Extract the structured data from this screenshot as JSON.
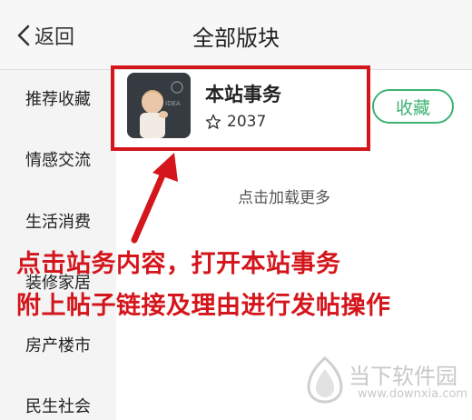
{
  "header": {
    "back_label": "返回",
    "title": "全部版块"
  },
  "sidebar": {
    "items": [
      {
        "label": "推荐收藏"
      },
      {
        "label": "情感交流"
      },
      {
        "label": "生活消费"
      },
      {
        "label": "装修家居"
      },
      {
        "label": "房产楼市"
      },
      {
        "label": "民生社会"
      }
    ]
  },
  "board": {
    "name": "本站事务",
    "star_count": "2037",
    "favorite_label": "收藏"
  },
  "list": {
    "load_more_label": "点击加载更多"
  },
  "annotation": {
    "line1": "点击站务内容，打开本站事务",
    "line2": "附上帖子链接及理由进行发帖操作",
    "color": "#d4161c"
  },
  "watermark": {
    "name": "当下软件园",
    "url": "www.downxia.com"
  },
  "colors": {
    "accent_green": "#3cb371",
    "annotation_red": "#d4161c"
  },
  "icons": {
    "back": "chevron-left-icon",
    "star": "star-outline-icon"
  }
}
